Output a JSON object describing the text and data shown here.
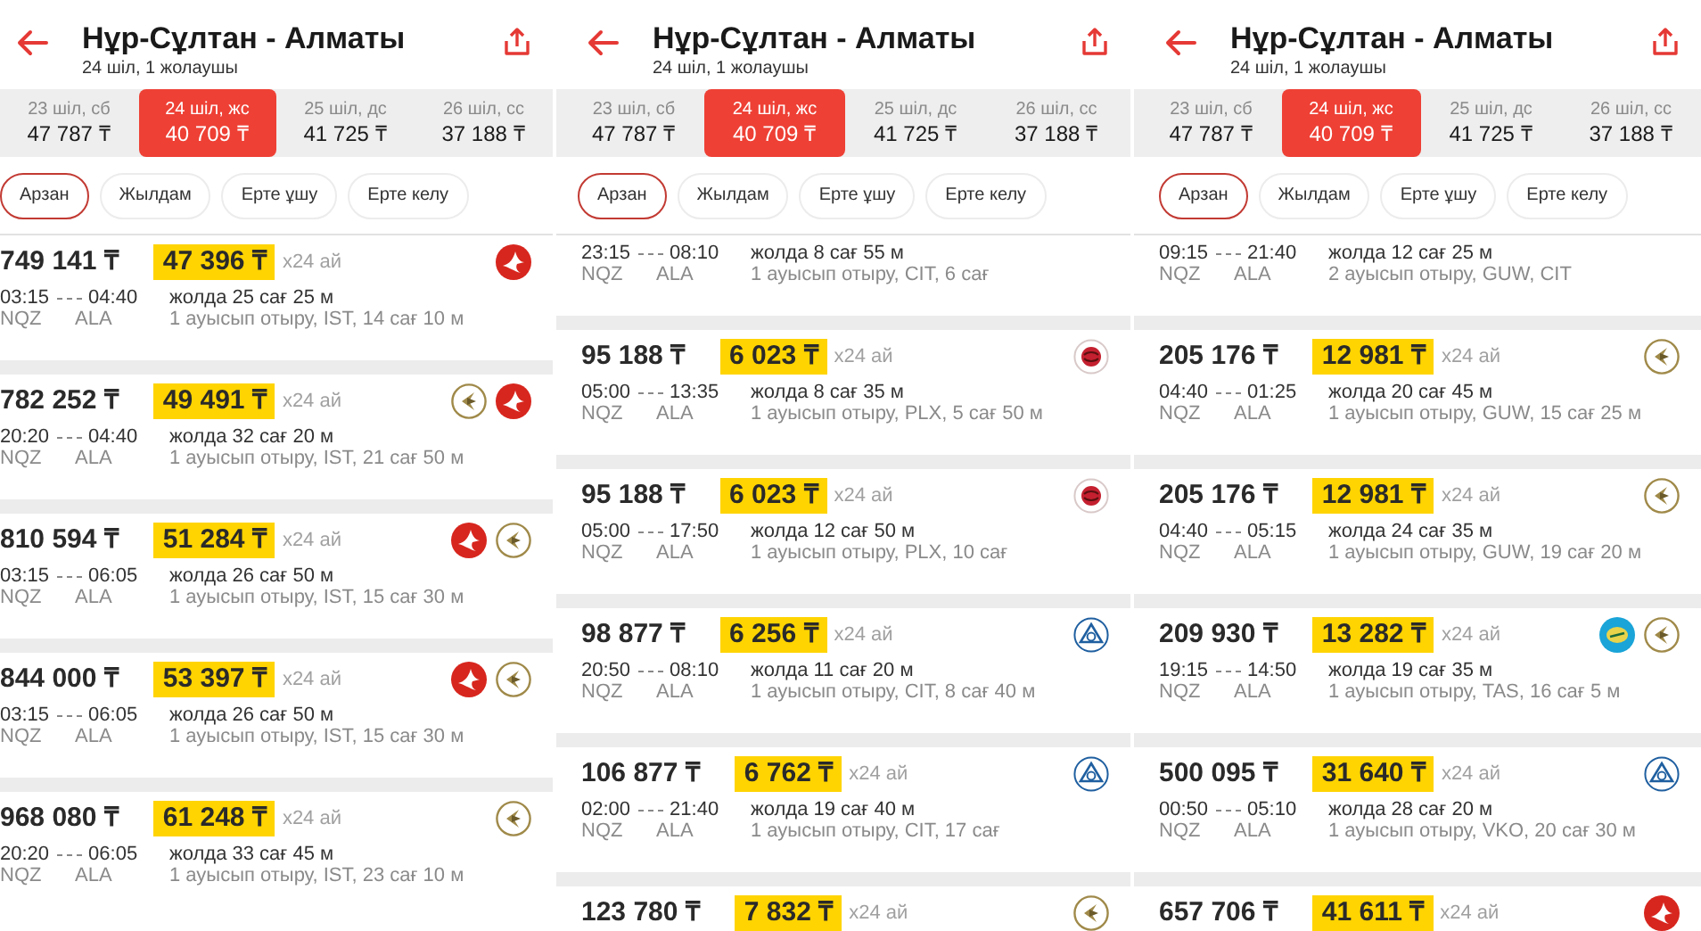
{
  "panels": [
    {
      "header": {
        "title": "Нұр-Сұлтан - Алматы",
        "subtitle": "24 шіл, 1 жолаушы"
      },
      "dates": [
        {
          "label": "23 шіл, сб",
          "price": "47 787 ₸",
          "selected": false
        },
        {
          "label": "24 шіл, жс",
          "price": "40 709 ₸",
          "selected": true
        },
        {
          "label": "25 шіл, дс",
          "price": "41 725 ₸",
          "selected": false
        },
        {
          "label": "26 шіл, сс",
          "price": "37 188 ₸",
          "selected": false
        }
      ],
      "filters": [
        {
          "label": "Арзан",
          "selected": true
        },
        {
          "label": "Жылдам",
          "selected": false
        },
        {
          "label": "Ерте ұшу",
          "selected": false
        },
        {
          "label": "Ерте келу",
          "selected": false
        }
      ],
      "flights": [
        {
          "price": "749 141 ₸",
          "monthly": "47 396 ₸",
          "term": "x24 ай",
          "depart": "03:15",
          "arrive": "04:40",
          "from": "NQZ",
          "to": "ALA",
          "duration": "жолда 25 сағ 25 м",
          "stops": "1 ауысып отыру, IST, 14 сағ 10 м",
          "airlines": [
            {
              "kind": "crescent"
            }
          ]
        },
        {
          "price": "782 252 ₸",
          "monthly": "49 491 ₸",
          "term": "x24 ай",
          "depart": "20:20",
          "arrive": "04:40",
          "from": "NQZ",
          "to": "ALA",
          "duration": "жолда 32 сағ 20 м",
          "stops": "1 ауысып отыру, IST, 21 сағ 50 м",
          "airlines": [
            {
              "kind": "chevron"
            },
            {
              "kind": "crescent"
            }
          ]
        },
        {
          "price": "810 594 ₸",
          "monthly": "51 284 ₸",
          "term": "x24 ай",
          "depart": "03:15",
          "arrive": "06:05",
          "from": "NQZ",
          "to": "ALA",
          "duration": "жолда 26 сағ 50 м",
          "stops": "1 ауысып отыру, IST, 15 сағ 30 м",
          "airlines": [
            {
              "kind": "crescent"
            },
            {
              "kind": "chevron"
            }
          ]
        },
        {
          "price": "844 000 ₸",
          "monthly": "53 397 ₸",
          "term": "x24 ай",
          "depart": "03:15",
          "arrive": "06:05",
          "from": "NQZ",
          "to": "ALA",
          "duration": "жолда 26 сағ 50 м",
          "stops": "1 ауысып отыру, IST, 15 сағ 30 м",
          "airlines": [
            {
              "kind": "crescent"
            },
            {
              "kind": "chevron"
            }
          ]
        },
        {
          "price": "968 080 ₸",
          "monthly": "61 248 ₸",
          "term": "x24 ай",
          "depart": "20:20",
          "arrive": "06:05",
          "from": "NQZ",
          "to": "ALA",
          "duration": "жолда 33 сағ 45 м",
          "stops": "1 ауысып отыру, IST, 23 сағ 10 м",
          "airlines": [
            {
              "kind": "chevron"
            }
          ]
        }
      ]
    },
    {
      "header": {
        "title": "Нұр-Сұлтан - Алматы",
        "subtitle": "24 шіл, 1 жолаушы"
      },
      "dates": [
        {
          "label": "23 шіл, сб",
          "price": "47 787 ₸",
          "selected": false
        },
        {
          "label": "24 шіл, жс",
          "price": "40 709 ₸",
          "selected": true
        },
        {
          "label": "25 шіл, дс",
          "price": "41 725 ₸",
          "selected": false
        },
        {
          "label": "26 шіл, сс",
          "price": "37 188 ₸",
          "selected": false
        }
      ],
      "filters": [
        {
          "label": "Арзан",
          "selected": true
        },
        {
          "label": "Жылдам",
          "selected": false
        },
        {
          "label": "Ерте ұшу",
          "selected": false
        },
        {
          "label": "Ерте келу",
          "selected": false
        }
      ],
      "flights": [
        {
          "depart": "23:15",
          "arrive": "08:10",
          "from": "NQZ",
          "to": "ALA",
          "duration": "жолда 8 сағ 55 м",
          "stops": "1 ауысып отыру, CIT, 6 сағ"
        },
        {
          "price": "95 188 ₸",
          "monthly": "6 023 ₸",
          "term": "x24 ай",
          "depart": "05:00",
          "arrive": "13:35",
          "from": "NQZ",
          "to": "ALA",
          "duration": "жолда 8 сағ 35 м",
          "stops": "1 ауысып отыру, PLX, 5 сағ 50 м",
          "airlines": [
            {
              "kind": "flower"
            }
          ]
        },
        {
          "price": "95 188 ₸",
          "monthly": "6 023 ₸",
          "term": "x24 ай",
          "depart": "05:00",
          "arrive": "17:50",
          "from": "NQZ",
          "to": "ALA",
          "duration": "жолда 12 сағ 50 м",
          "stops": "1 ауысып отыру, PLX, 10 сағ",
          "airlines": [
            {
              "kind": "flower"
            }
          ]
        },
        {
          "price": "98 877 ₸",
          "monthly": "6 256 ₸",
          "term": "x24 ай",
          "depart": "20:50",
          "arrive": "08:10",
          "from": "NQZ",
          "to": "ALA",
          "duration": "жолда 11 сағ 20 м",
          "stops": "1 ауысып отыру, CIT, 8 сағ 40 м",
          "airlines": [
            {
              "kind": "triangle"
            }
          ]
        },
        {
          "price": "106 877 ₸",
          "monthly": "6 762 ₸",
          "term": "x24 ай",
          "depart": "02:00",
          "arrive": "21:40",
          "from": "NQZ",
          "to": "ALA",
          "duration": "жолда 19 сағ 40 м",
          "stops": "1 ауысып отыру, CIT, 17 сағ",
          "airlines": [
            {
              "kind": "triangle"
            }
          ]
        },
        {
          "price": "123 780 ₸",
          "monthly": "7 832 ₸",
          "term": "x24 ай",
          "airlines": [
            {
              "kind": "chevron"
            }
          ]
        }
      ]
    },
    {
      "header": {
        "title": "Нұр-Сұлтан - Алматы",
        "subtitle": "24 шіл, 1 жолаушы"
      },
      "dates": [
        {
          "label": "23 шіл, сб",
          "price": "47 787 ₸",
          "selected": false
        },
        {
          "label": "24 шіл, жс",
          "price": "40 709 ₸",
          "selected": true
        },
        {
          "label": "25 шіл, дс",
          "price": "41 725 ₸",
          "selected": false
        },
        {
          "label": "26 шіл, сс",
          "price": "37 188 ₸",
          "selected": false
        }
      ],
      "filters": [
        {
          "label": "Арзан",
          "selected": true
        },
        {
          "label": "Жылдам",
          "selected": false
        },
        {
          "label": "Ерте ұшу",
          "selected": false
        },
        {
          "label": "Ерте келу",
          "selected": false
        }
      ],
      "flights": [
        {
          "depart": "09:15",
          "arrive": "21:40",
          "from": "NQZ",
          "to": "ALA",
          "duration": "жолда 12 сағ 25 м",
          "stops": "2 ауысып отыру, GUW, CIT"
        },
        {
          "price": "205 176 ₸",
          "monthly": "12 981 ₸",
          "term": "x24 ай",
          "depart": "04:40",
          "arrive": "01:25",
          "from": "NQZ",
          "to": "ALA",
          "duration": "жолда 20 сағ 45 м",
          "stops": "1 ауысып отыру, GUW, 15 сағ 25 м",
          "airlines": [
            {
              "kind": "chevron"
            }
          ]
        },
        {
          "price": "205 176 ₸",
          "monthly": "12 981 ₸",
          "term": "x24 ай",
          "depart": "04:40",
          "arrive": "05:15",
          "from": "NQZ",
          "to": "ALA",
          "duration": "жолда 24 сағ 35 м",
          "stops": "1 ауысып отыру, GUW, 19 сағ 20 м",
          "airlines": [
            {
              "kind": "chevron"
            }
          ]
        },
        {
          "price": "209 930 ₸",
          "monthly": "13 282 ₸",
          "term": "x24 ай",
          "depart": "19:15",
          "arrive": "14:50",
          "from": "NQZ",
          "to": "ALA",
          "duration": "жолда 19 сағ 35 м",
          "stops": "1 ауысып отыру, TAS, 16 сағ 5 м",
          "airlines": [
            {
              "kind": "disc"
            },
            {
              "kind": "chevron"
            }
          ]
        },
        {
          "price": "500 095 ₸",
          "monthly": "31 640 ₸",
          "term": "x24 ай",
          "depart": "00:50",
          "arrive": "05:10",
          "from": "NQZ",
          "to": "ALA",
          "duration": "жолда 28 сағ 20 м",
          "stops": "1 ауысып отыру, VKO, 20 сағ 30 м",
          "airlines": [
            {
              "kind": "triangle"
            }
          ]
        },
        {
          "price": "657 706 ₸",
          "monthly": "41 611 ₸",
          "term": "x24 ай",
          "airlines": [
            {
              "kind": "crescent"
            }
          ]
        }
      ]
    }
  ]
}
